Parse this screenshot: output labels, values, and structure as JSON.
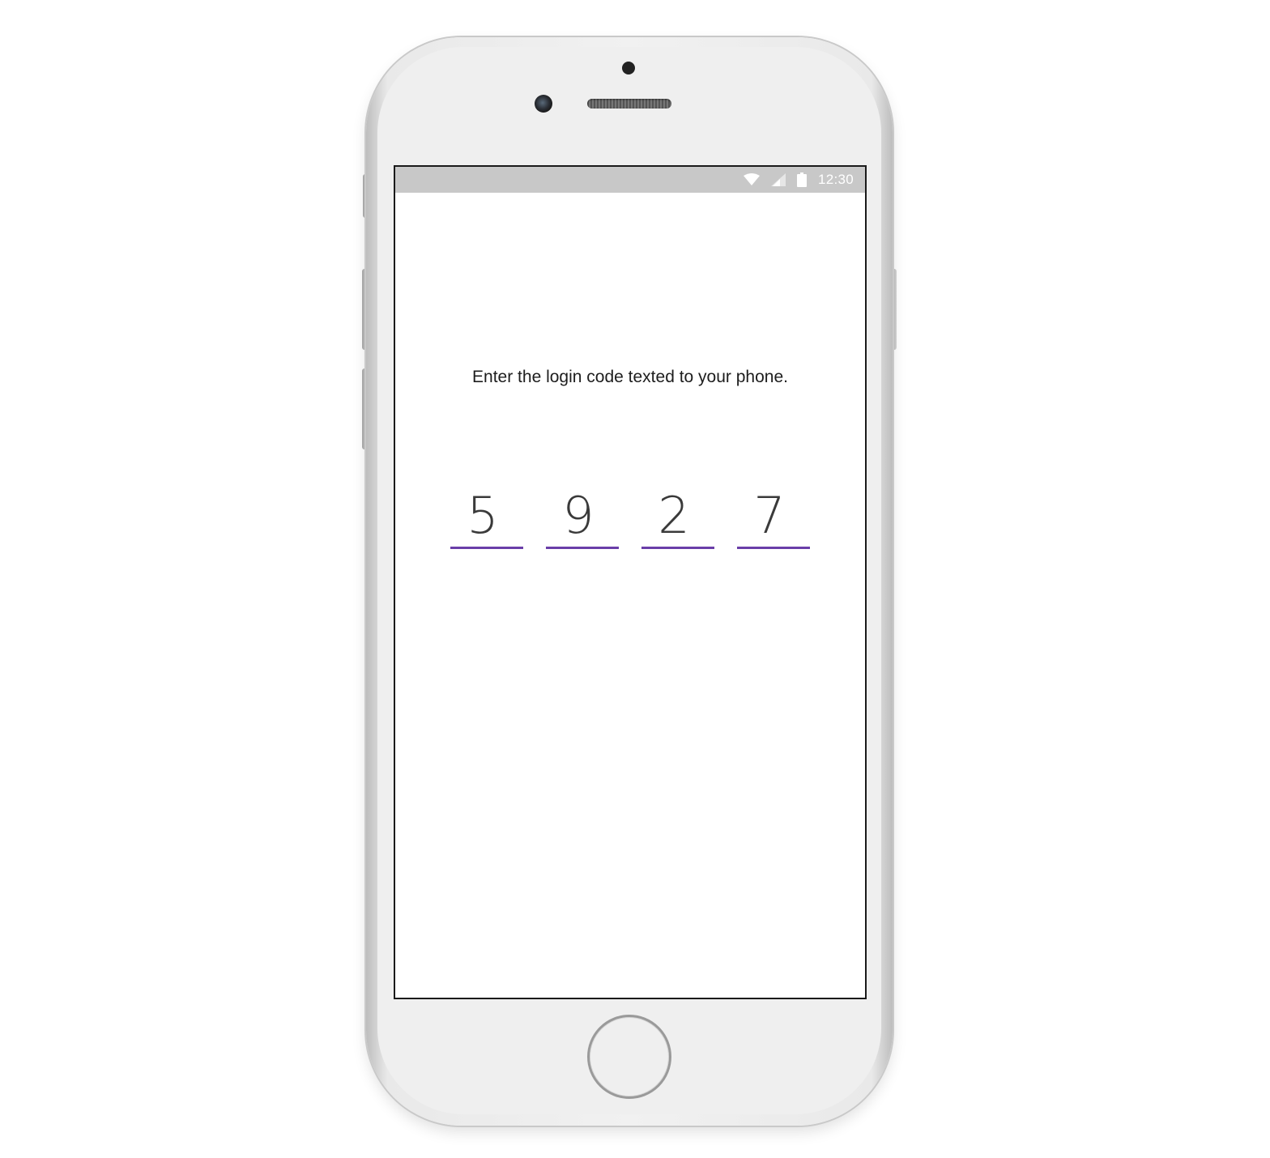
{
  "status_bar": {
    "time": "12:30",
    "icons": [
      "wifi-icon",
      "signal-icon",
      "battery-icon"
    ]
  },
  "login": {
    "prompt": "Enter the login code texted to your phone.",
    "code_digits": [
      "5",
      "9",
      "2",
      "7"
    ]
  },
  "colors": {
    "accent": "#6a3ea8",
    "status_bar": "#c8c8c8",
    "text": "#1d1d1d"
  }
}
